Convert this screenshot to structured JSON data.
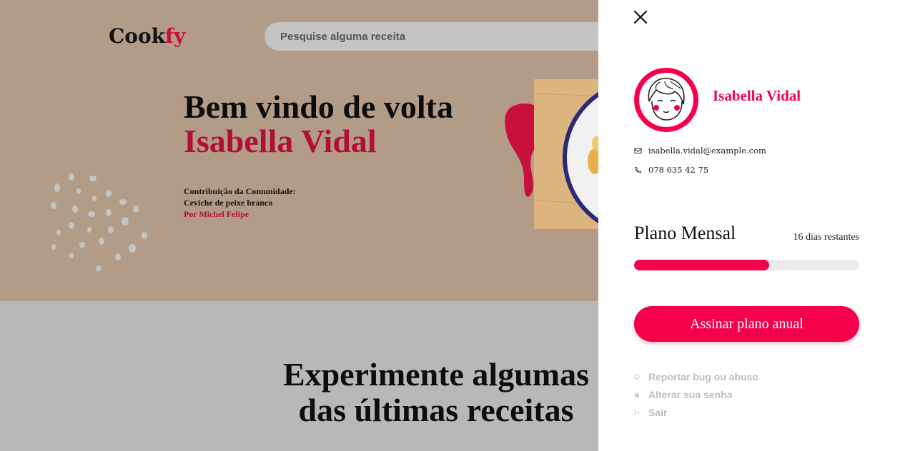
{
  "header": {
    "logo_main": "Cook",
    "logo_accent": "fy",
    "search_placeholder": "Pesquise alguma receita"
  },
  "hero": {
    "welcome": "Bem vindo de volta",
    "user_name": "Isabella Vidal",
    "contribution_label": "Contribuição da Comunidade:",
    "contribution_recipe": "Ceviche de peixe branco",
    "contribution_author": "Por Michel Felipe"
  },
  "section": {
    "title_line1": "Experimente algumas",
    "title_line2": "das últimas receitas"
  },
  "drawer": {
    "profile_name": "Isabella Vidal",
    "email": "isabella.vidal@example.com",
    "phone": "078 635 42 75",
    "plan_title": "Plano Mensal",
    "plan_remaining": "16 dias restantes",
    "plan_progress_fraction": 0.6,
    "cta_label": "Assinar plano anual",
    "menu": [
      {
        "label": "Reportar bug ou abuso",
        "icon": "circle-icon"
      },
      {
        "label": "Alterar sua senha",
        "icon": "lock-icon"
      },
      {
        "label": "Sair",
        "icon": "logout-icon"
      }
    ]
  },
  "colors": {
    "accent": "#f5004a",
    "brand_dark_accent": "#b10f36",
    "hero_bg": "#b39c87",
    "overlay_page_bg": "#b8b8b8",
    "muted_menu": "#bdbdbd"
  }
}
